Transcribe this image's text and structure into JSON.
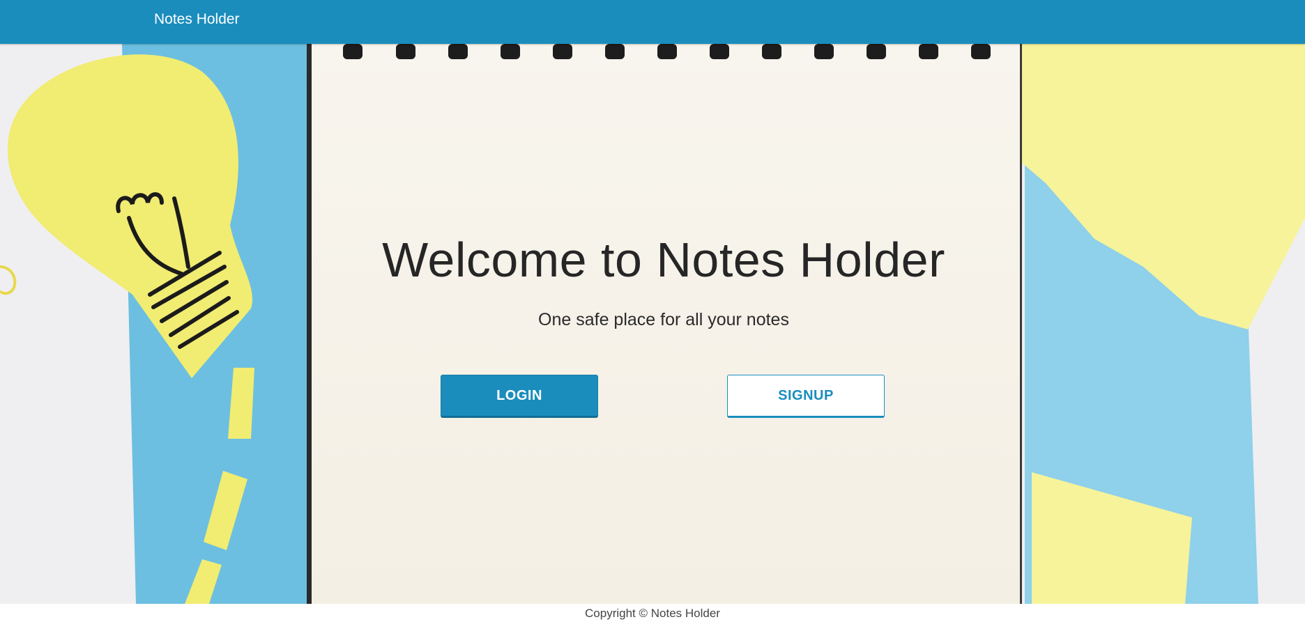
{
  "navbar": {
    "brand": "Notes Holder"
  },
  "hero": {
    "title": "Welcome to Notes Holder",
    "subtitle": "One safe place for all your notes",
    "login_label": "LOGIN",
    "signup_label": "SIGNUP"
  },
  "footer": {
    "text": "Copyright © Notes Holder"
  },
  "colors": {
    "primary": "#1a8dbd",
    "paper_blue": "#6fc0e0",
    "paper_yellow": "#f3ef79",
    "notebook": "#f7f3ea"
  }
}
